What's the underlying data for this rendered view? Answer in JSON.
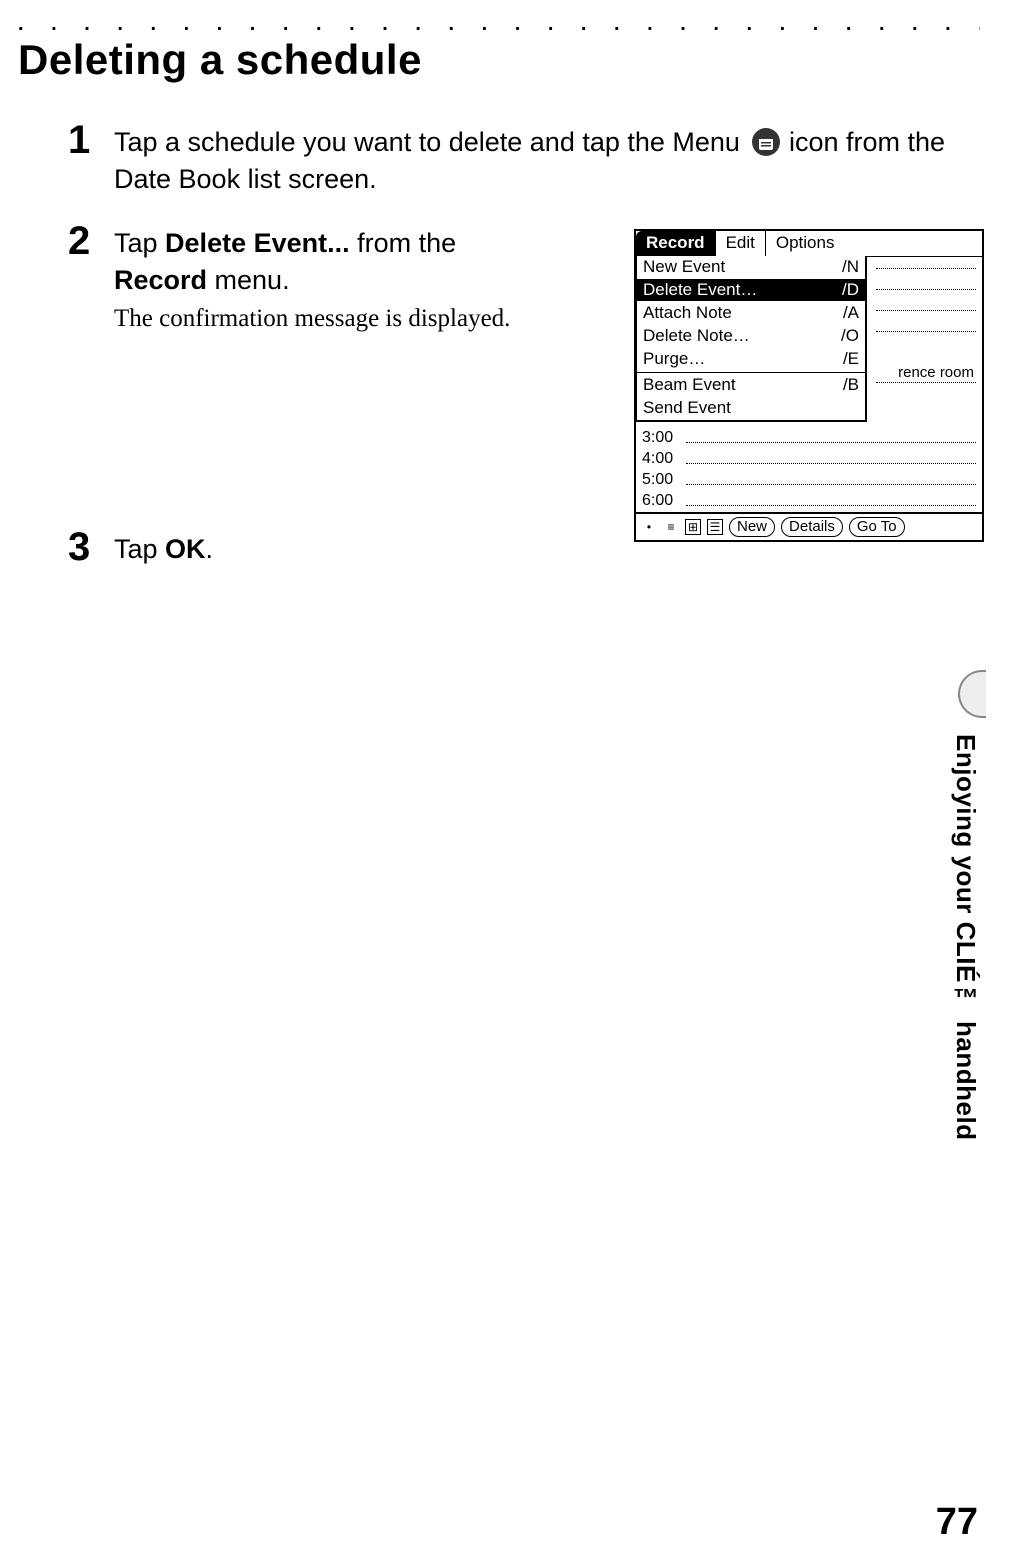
{
  "page": {
    "title": "Deleting a schedule",
    "sideTab": "Enjoying your CLIÉ™ handheld",
    "pageNumber": "77"
  },
  "steps": {
    "s1": {
      "num": "1",
      "pre": "Tap a schedule you want to delete and tap the Menu ",
      "post": " icon from the Date Book list screen."
    },
    "s2": {
      "num": "2",
      "textA": "Tap ",
      "bold1": "Delete Event...",
      "textB": " from the ",
      "bold2": "Record",
      "textC": " menu.",
      "sub": "The confirmation message is displayed."
    },
    "s3": {
      "num": "3",
      "textA": "Tap ",
      "bold1": "OK",
      "textB": "."
    }
  },
  "palm": {
    "menubar": {
      "record": "Record",
      "edit": "Edit",
      "options": "Options"
    },
    "menu": {
      "newEvent": {
        "label": "New Event",
        "sc": "/N"
      },
      "deleteEvent": {
        "label": "Delete Event…",
        "sc": "/D"
      },
      "attachNote": {
        "label": "Attach Note",
        "sc": "/A"
      },
      "deleteNote": {
        "label": "Delete Note…",
        "sc": "/O"
      },
      "purge": {
        "label": "Purge…",
        "sc": "/E"
      },
      "beamEvent": {
        "label": "Beam Event",
        "sc": "/B"
      },
      "sendEvent": {
        "label": "Send Event",
        "sc": ""
      }
    },
    "bg": {
      "renceRoom": "rence room"
    },
    "times": {
      "t1": "3:00",
      "t2": "4:00",
      "t3": "5:00",
      "t4": "6:00"
    },
    "toolbar": {
      "new": "New",
      "details": "Details",
      "goto": "Go To"
    }
  }
}
